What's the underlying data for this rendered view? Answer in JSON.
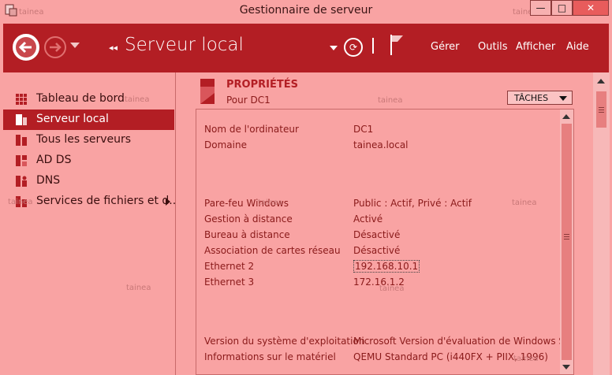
{
  "window": {
    "title": "Gestionnaire de serveur",
    "minimize": "—",
    "maximize": "□",
    "close": "✕",
    "watermark": "tainea"
  },
  "header": {
    "title": "Serveur local",
    "breadcrumb_glyph": "◂◂",
    "refresh_glyph": "⟳",
    "menu": [
      "Gérer",
      "Outils",
      "Afficher",
      "Aide"
    ]
  },
  "icons": {
    "back": "arrow-left-icon",
    "forward": "arrow-right-icon",
    "refresh": "refresh-icon",
    "flag": "flag-icon"
  },
  "colors": {
    "accent": "#b31e24",
    "background": "#f9a3a3",
    "text": "#8a1a1a"
  },
  "sidebar": {
    "items": [
      {
        "label": "Tableau de bord",
        "icon": "dashboard-icon"
      },
      {
        "label": "Serveur local",
        "icon": "server-icon",
        "selected": true
      },
      {
        "label": "Tous les serveurs",
        "icon": "servers-icon"
      },
      {
        "label": "AD DS",
        "icon": "ad-ds-icon"
      },
      {
        "label": "DNS",
        "icon": "dns-icon"
      },
      {
        "label": "Services de fichiers et d...",
        "icon": "file-services-icon",
        "has_submenu": true
      }
    ]
  },
  "properties": {
    "title": "PROPRIÉTÉS",
    "subtitle": "Pour DC1",
    "tasks_label": "TÂCHES",
    "rows": [
      {
        "key": "Nom de l'ordinateur",
        "value": "DC1"
      },
      {
        "key": "Domaine",
        "value": "tainea.local"
      },
      {
        "key": "Pare-feu Windows",
        "value": "Public : Actif, Privé : Actif"
      },
      {
        "key": "Gestion à distance",
        "value": "Activé"
      },
      {
        "key": "Bureau à distance",
        "value": "Désactivé"
      },
      {
        "key": "Association de cartes réseau",
        "value": "Désactivé"
      },
      {
        "key": "Ethernet 2",
        "value": "192.168.10.1"
      },
      {
        "key": "Ethernet 3",
        "value": "172.16.1.2"
      },
      {
        "key": "Version du système d'exploitation",
        "value": "Microsoft Version d'évaluation de Windows Serve"
      },
      {
        "key": "Informations sur le matériel",
        "value": "QEMU Standard PC (i440FX + PIIX, 1996)"
      }
    ]
  }
}
